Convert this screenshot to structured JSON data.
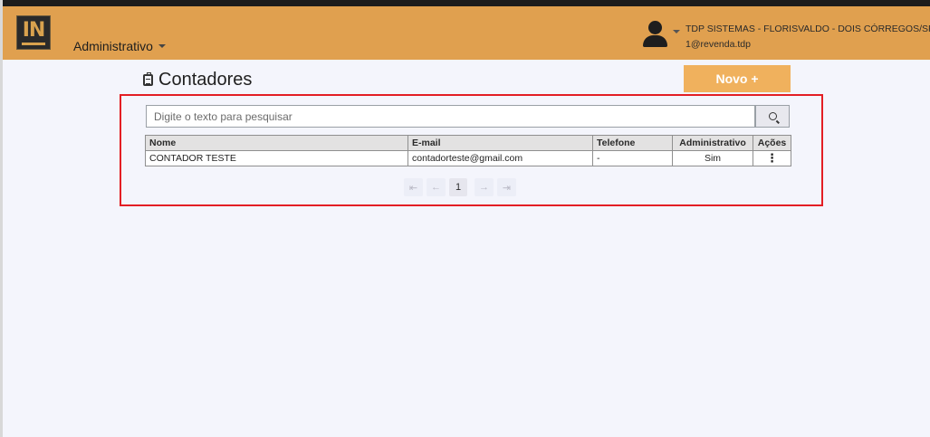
{
  "header": {
    "logo_text": "IN",
    "menu_label": "Administrativo",
    "user_name": "TDP SISTEMAS - FLORISVALDO - DOIS CÓRREGOS/SP",
    "user_login": "1@revenda.tdp"
  },
  "page": {
    "title": "Contadores",
    "new_button": "Novo +"
  },
  "search": {
    "placeholder": "Digite o texto para pesquisar"
  },
  "table": {
    "headers": [
      "Nome",
      "E-mail",
      "Telefone",
      "Administrativo",
      "Ações"
    ],
    "rows": [
      {
        "nome": "CONTADOR TESTE",
        "email": "contadorteste@gmail.com",
        "telefone": "-",
        "administrativo": "Sim",
        "acoes": "⋮"
      }
    ]
  },
  "pagination": {
    "first": "⇤",
    "prev": "←",
    "current": "1",
    "next": "→",
    "last": "⇥"
  },
  "colors": {
    "header_bg": "#e0a04f",
    "button_bg": "#f0b15d",
    "highlight_border": "#e31e24",
    "page_bg": "#f4f5fc"
  }
}
